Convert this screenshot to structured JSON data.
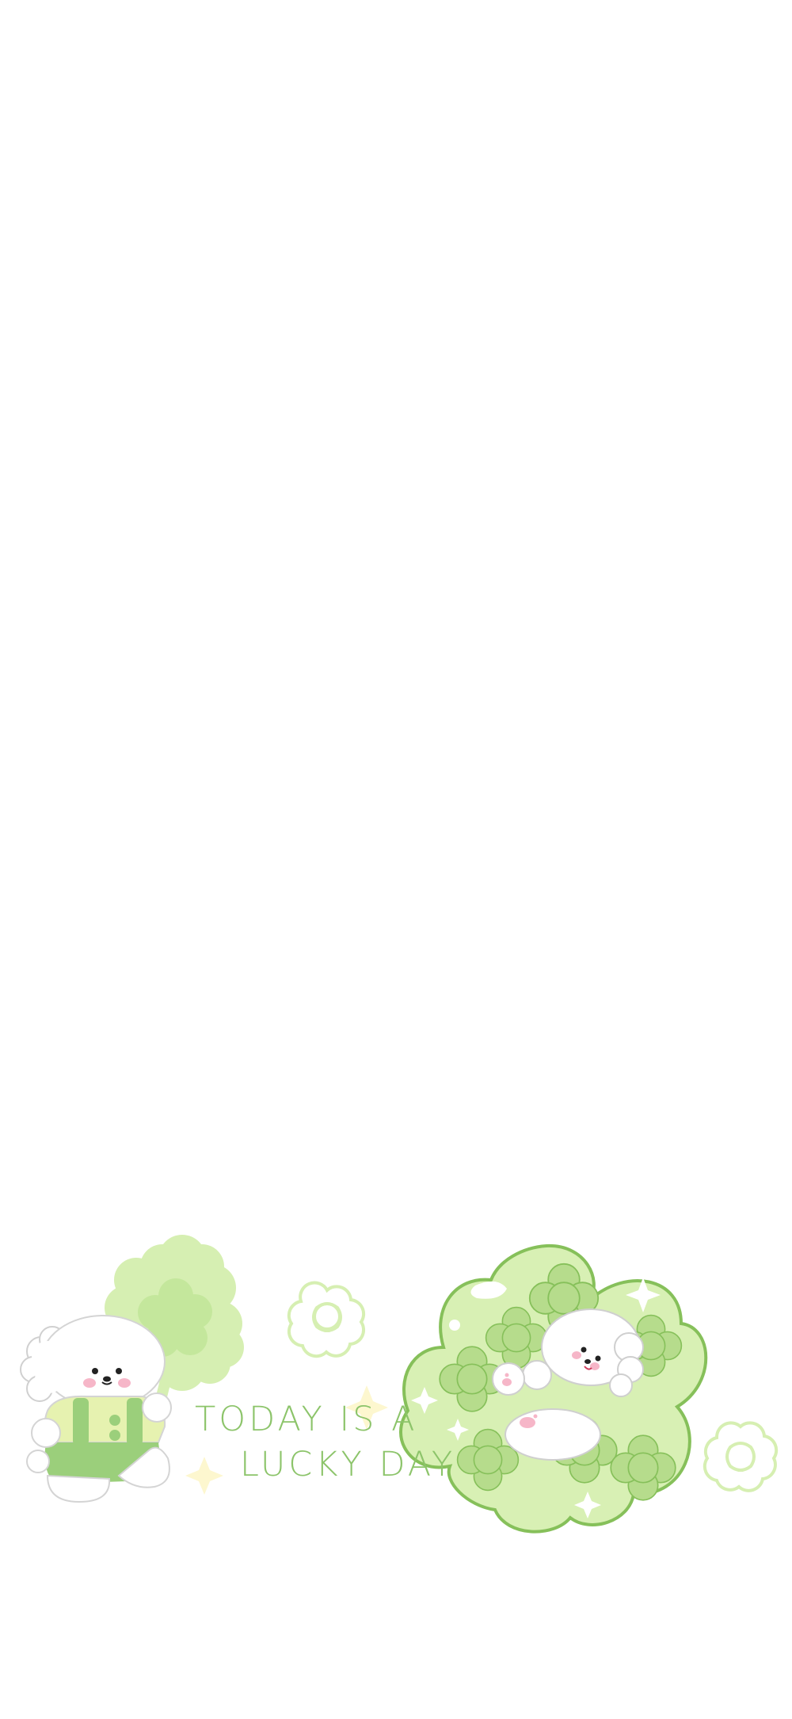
{
  "wallpaper": {
    "caption": {
      "line1": "TODAY IS A",
      "line2": "LUCKY DAY"
    },
    "colors": {
      "background": "#ffffff",
      "text_green": "#8cc46a",
      "clover_light": "#d8f0b4",
      "clover_mid": "#c6e89a",
      "outline_green": "#86c05a",
      "overall_green": "#98cc7a",
      "shirt_yellow": "#e6f2b0",
      "cheek_pink": "#f6b6c8",
      "sparkle_yellow": "#fdf7cf"
    },
    "icons": [
      "four-leaf-clover-icon",
      "puppy-icon",
      "sparkle-icon",
      "flower-outline-icon"
    ]
  }
}
